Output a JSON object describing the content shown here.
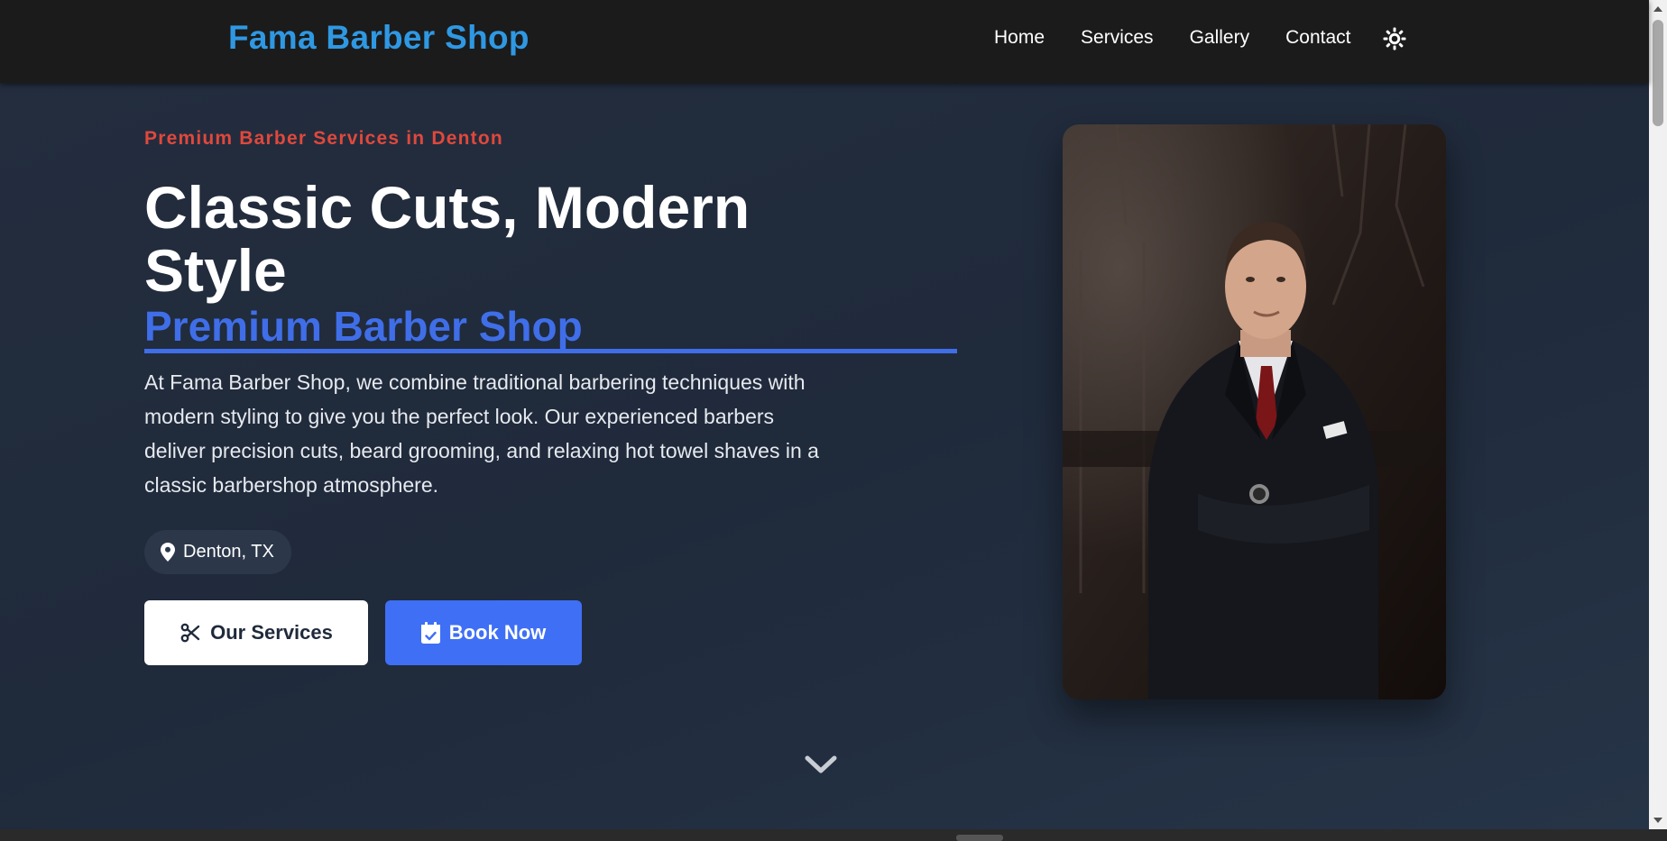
{
  "nav": {
    "brand": "Fama Barber Shop",
    "links": [
      {
        "label": "Home"
      },
      {
        "label": "Services"
      },
      {
        "label": "Gallery"
      },
      {
        "label": "Contact"
      }
    ],
    "theme_toggle_icon": "sun-icon"
  },
  "hero": {
    "eyebrow": "Premium Barber Services in Denton",
    "headline": "Classic Cuts, Modern Style",
    "subhead": "Premium Barber Shop",
    "description": "At Fama Barber Shop, we combine traditional barbering techniques with modern styling to give you the perfect look. Our experienced barbers deliver precision cuts, beard grooming, and relaxing hot towel shaves in a classic barbershop atmosphere.",
    "location": {
      "icon": "map-pin-icon",
      "label": "Denton, TX"
    },
    "buttons": {
      "services": {
        "icon": "scissors-icon",
        "label": "Our Services"
      },
      "book": {
        "icon": "calendar-check-icon",
        "label": "Book Now"
      }
    },
    "scroll_icon": "chevron-down-icon"
  },
  "colors": {
    "brand": "#2f98e3",
    "accent_red": "#e0483c",
    "accent_blue": "#3f6ee8",
    "navbar_bg": "#1b1b1b",
    "hero_bg": "#1f2a3b"
  }
}
